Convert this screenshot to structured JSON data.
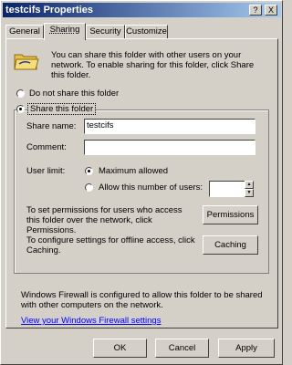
{
  "window": {
    "title": "testcifs Properties",
    "help_label": "?",
    "close_label": "X"
  },
  "tabs": [
    {
      "label": "General"
    },
    {
      "label": "Sharing"
    },
    {
      "label": "Security"
    },
    {
      "label": "Customize"
    }
  ],
  "sharing": {
    "intro_text": "You can share this folder with other users on your network. To enable sharing for this folder, click Share this folder.",
    "do_not_share_label": "Do not share this folder",
    "share_label": "Share this folder",
    "share_name_label": "Share name:",
    "share_name_value": "testcifs",
    "comment_label": "Comment:",
    "comment_value": "",
    "user_limit_label": "User limit:",
    "maximum_allowed_label": "Maximum allowed",
    "allow_number_label": "Allow this number of users:",
    "allow_number_value": "",
    "permissions_text": "To set permissions for users who access this folder over the network, click Permissions.",
    "permissions_button": "Permissions",
    "caching_text": "To configure settings for offline access, click Caching.",
    "caching_button": "Caching",
    "firewall_text": "Windows Firewall is configured to allow this folder to be shared with other computers on the network.",
    "firewall_link": "View your Windows Firewall settings"
  },
  "footer": {
    "ok": "OK",
    "cancel": "Cancel",
    "apply": "Apply"
  },
  "colors": {
    "title_start": "#0a246a",
    "title_end": "#a6caf0",
    "face": "#d4d0c8",
    "link": "#0000ff"
  }
}
